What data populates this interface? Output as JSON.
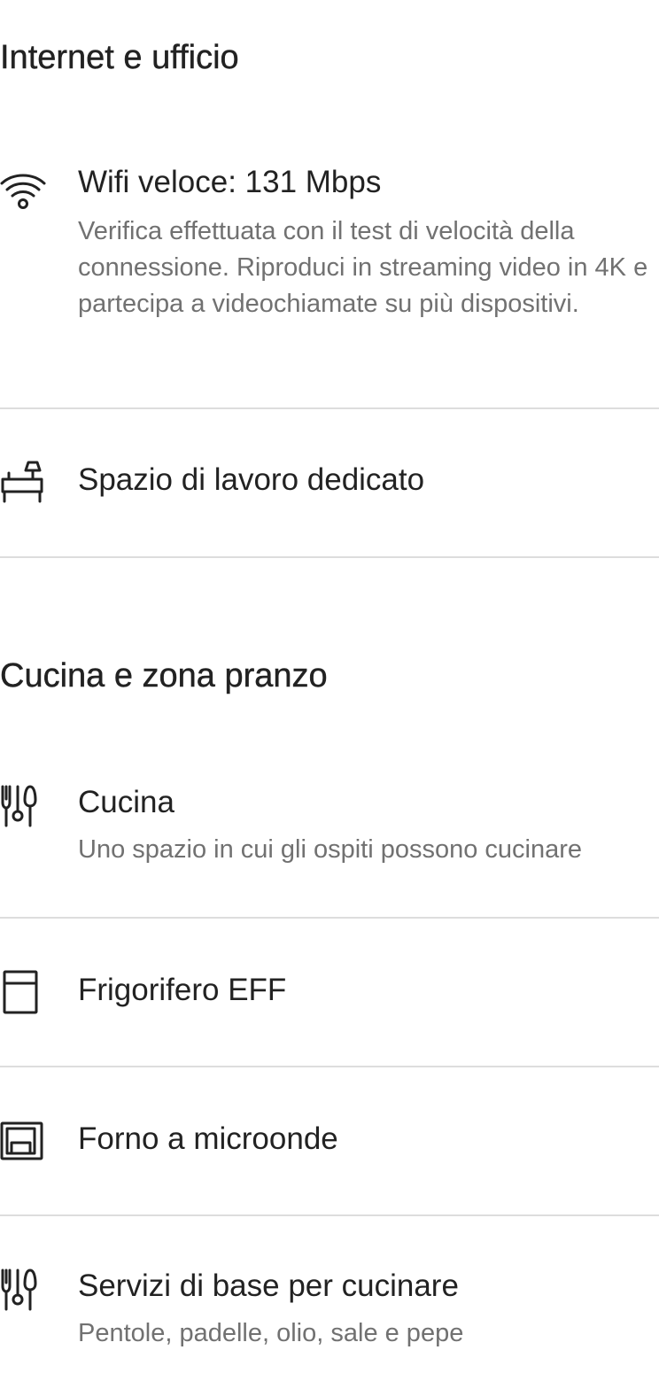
{
  "sections": [
    {
      "title": "Internet e ufficio",
      "items": [
        {
          "icon": "wifi-icon",
          "label": "Wifi veloce: 131 Mbps",
          "description": "Verifica effettuata con il test di velocità della connessione. Riproduci in streaming video in 4K e partecipa a videochiamate su più dispositivi."
        },
        {
          "icon": "workspace-desk-icon",
          "label": "Spazio di lavoro dedicato"
        }
      ]
    },
    {
      "title": "Cucina e zona pranzo",
      "items": [
        {
          "icon": "kitchen-utensils-icon",
          "label": "Cucina",
          "description": "Uno spazio in cui gli ospiti possono cucinare"
        },
        {
          "icon": "fridge-icon",
          "label": "Frigorifero EFF"
        },
        {
          "icon": "microwave-icon",
          "label": "Forno a microonde"
        },
        {
          "icon": "cooking-basics-icon",
          "label": "Servizi di base per cucinare",
          "description": "Pentole, padelle, olio, sale e pepe"
        }
      ]
    }
  ]
}
